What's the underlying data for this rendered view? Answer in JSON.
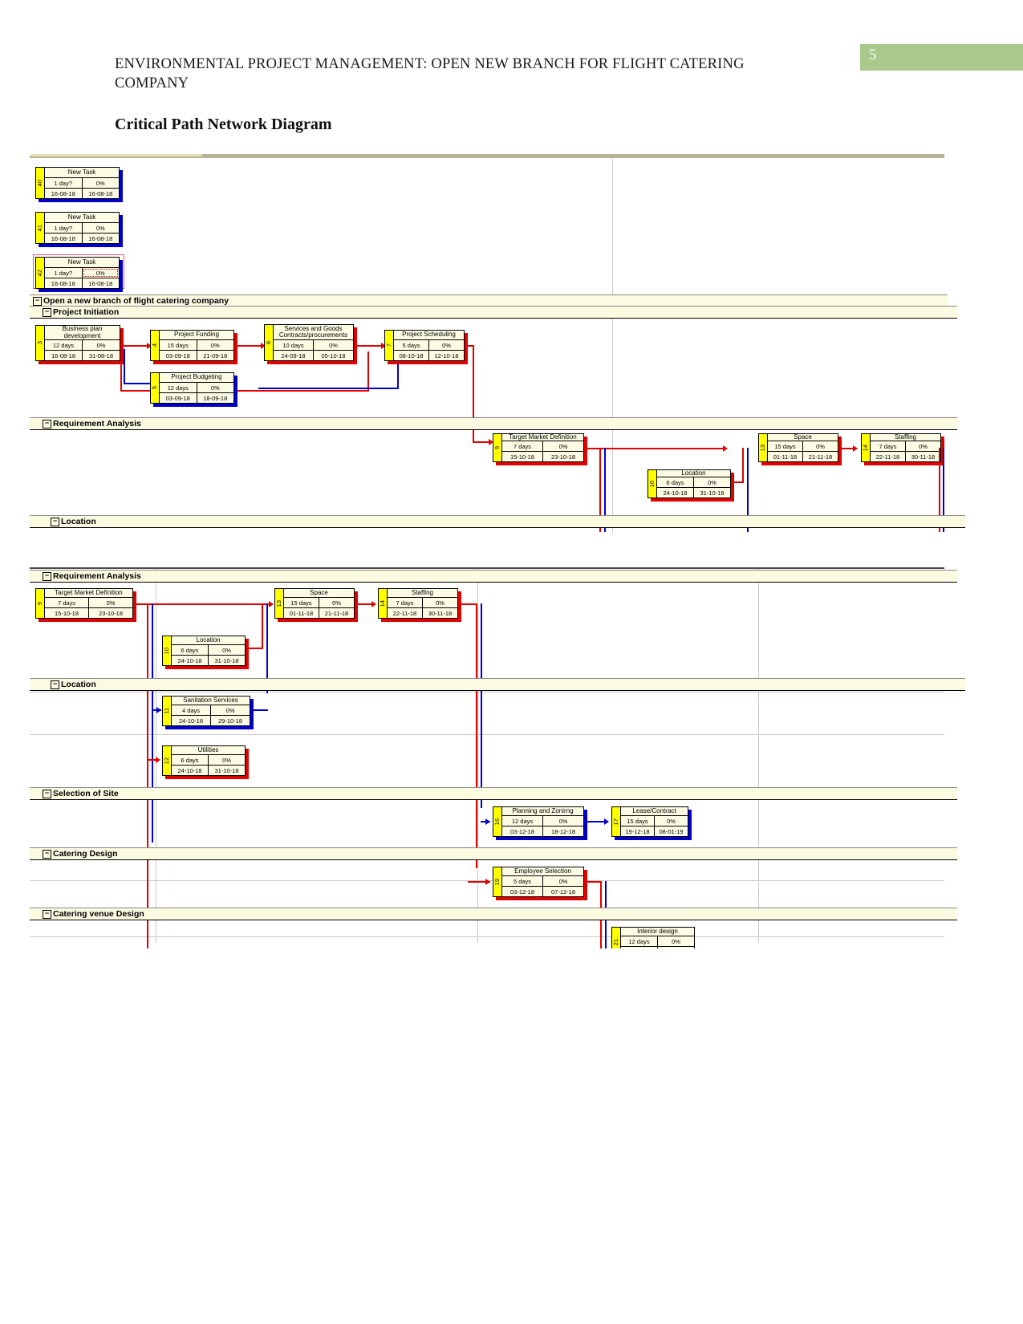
{
  "header": {
    "page_number": "5",
    "title_line1": "ENVIRONMENTAL  PROJECT  MANAGEMENT:  OPEN  NEW  BRANCH  FOR  FLIGHT  CATERING",
    "title_line2": "COMPANY",
    "section_heading": "Critical Path Network Diagram"
  },
  "expander_glyph": "−",
  "groups": [
    {
      "id": "root",
      "label": "Open a new branch of flight catering company"
    },
    {
      "id": "project-initiation",
      "label": "Project Initiation"
    },
    {
      "id": "requirement-analysis",
      "label": "Requirement Analysis"
    },
    {
      "id": "location",
      "label": "Location"
    },
    {
      "id": "requirement-analysis-2",
      "label": "Requirement Analysis"
    },
    {
      "id": "location-2",
      "label": "Location"
    },
    {
      "id": "selection-of-site",
      "label": "Selection of Site"
    },
    {
      "id": "catering-design",
      "label": "Catering Design"
    },
    {
      "id": "catering-venue-design",
      "label": "Catering venue Design"
    }
  ],
  "nodes": [
    {
      "key": "n40",
      "id": "40",
      "name": "New Task",
      "duration": "1 day?",
      "percent": "0%",
      "start": "16-08-18",
      "finish": "16-08-18",
      "critical": false
    },
    {
      "key": "n41",
      "id": "41",
      "name": "New Task",
      "duration": "1 day?",
      "percent": "0%",
      "start": "16-08-18",
      "finish": "16-08-18",
      "critical": false
    },
    {
      "key": "n42",
      "id": "42",
      "name": "New Task",
      "duration": "1 day?",
      "percent": "0%",
      "start": "16-08-18",
      "finish": "16-08-18",
      "critical": false,
      "selected": true
    },
    {
      "key": "n3",
      "id": "3",
      "name": "Business plan development",
      "duration": "12 days",
      "percent": "0%",
      "start": "16-08-18",
      "finish": "31-08-18",
      "critical": true
    },
    {
      "key": "n4",
      "id": "4",
      "name": "Project Funding",
      "duration": "15 days",
      "percent": "0%",
      "start": "03-09-18",
      "finish": "21-09-18",
      "critical": true
    },
    {
      "key": "n5",
      "id": "5",
      "name": "Project Budgeting",
      "duration": "12 days",
      "percent": "0%",
      "start": "03-09-18",
      "finish": "18-09-18",
      "critical": false
    },
    {
      "key": "n6",
      "id": "6",
      "name": "Services and Goods Contracts/procurements",
      "duration": "10 days",
      "percent": "0%",
      "start": "24-09-18",
      "finish": "05-10-18",
      "critical": true
    },
    {
      "key": "n7",
      "id": "7",
      "name": "Project Scheduling",
      "duration": "5 days",
      "percent": "0%",
      "start": "08-10-18",
      "finish": "12-10-18",
      "critical": true
    },
    {
      "key": "n9a",
      "id": "9",
      "name": "Target Market Definition",
      "duration": "7 days",
      "percent": "0%",
      "start": "15-10-18",
      "finish": "23-10-18",
      "critical": true
    },
    {
      "key": "n10a",
      "id": "10",
      "name": "Location",
      "duration": "6 days",
      "percent": "0%",
      "start": "24-10-18",
      "finish": "31-10-18",
      "critical": true
    },
    {
      "key": "n13a",
      "id": "13",
      "name": "Space",
      "duration": "15 days",
      "percent": "0%",
      "start": "01-11-18",
      "finish": "21-11-18",
      "critical": true
    },
    {
      "key": "n14a",
      "id": "14",
      "name": "Staffing",
      "duration": "7 days",
      "percent": "0%",
      "start": "22-11-18",
      "finish": "30-11-18",
      "critical": true
    },
    {
      "key": "n9b",
      "id": "9",
      "name": "Target Market Definition",
      "duration": "7 days",
      "percent": "0%",
      "start": "15-10-18",
      "finish": "23-10-18",
      "critical": true
    },
    {
      "key": "n10b",
      "id": "10",
      "name": "Location",
      "duration": "6 days",
      "percent": "0%",
      "start": "24-10-18",
      "finish": "31-10-18",
      "critical": true
    },
    {
      "key": "n13b",
      "id": "13",
      "name": "Space",
      "duration": "15 days",
      "percent": "0%",
      "start": "01-11-18",
      "finish": "21-11-18",
      "critical": true
    },
    {
      "key": "n14b",
      "id": "14",
      "name": "Staffing",
      "duration": "7 days",
      "percent": "0%",
      "start": "22-11-18",
      "finish": "30-11-18",
      "critical": true
    },
    {
      "key": "n11",
      "id": "11",
      "name": "Sanitation Services",
      "duration": "4 days",
      "percent": "0%",
      "start": "24-10-18",
      "finish": "29-10-18",
      "critical": false
    },
    {
      "key": "n12",
      "id": "12",
      "name": "Utilities",
      "duration": "6 days",
      "percent": "0%",
      "start": "24-10-18",
      "finish": "31-10-18",
      "critical": true
    },
    {
      "key": "n16",
      "id": "16",
      "name": "Planning and Zonirng",
      "duration": "12 days",
      "percent": "0%",
      "start": "03-12-18",
      "finish": "18-12-18",
      "critical": false
    },
    {
      "key": "n17",
      "id": "17",
      "name": "Lease/Contract",
      "duration": "15 days",
      "percent": "0%",
      "start": "19-12-18",
      "finish": "08-01-19",
      "critical": false
    },
    {
      "key": "n19",
      "id": "19",
      "name": "Employee Selection",
      "duration": "5 days",
      "percent": "0%",
      "start": "03-12-18",
      "finish": "07-12-18",
      "critical": true
    },
    {
      "key": "n21",
      "id": "21",
      "name": "Interior design",
      "duration": "12 days",
      "percent": "0%",
      "start": "",
      "finish": "",
      "critical": false
    }
  ],
  "colors": {
    "critical": "#e00000",
    "noncritical": "#0000cc",
    "node_id_fill": "#ffff00",
    "node_fill": "#fcfce4",
    "group_fill": "#fbfbe2",
    "page_badge": "#a9c88c"
  }
}
